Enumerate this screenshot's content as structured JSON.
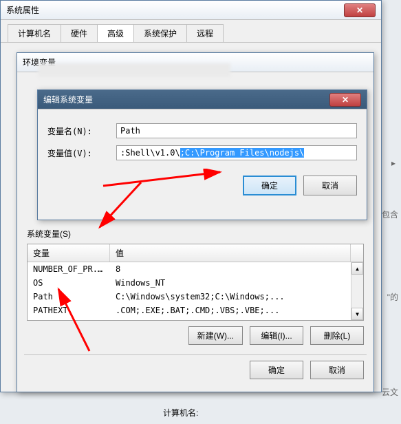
{
  "outer_bg": {
    "bottom_label": "计算机名:",
    "partial1": "\"的",
    "partial2": "包含",
    "partial3": "…",
    "partial4": "云文"
  },
  "sys_props": {
    "title": "系统属性",
    "tabs": [
      "计算机名",
      "硬件",
      "高级",
      "系统保护",
      "远程"
    ],
    "active_tab_index": 2
  },
  "env_vars": {
    "title": "环境变量",
    "sys_vars_label": "系统变量(S)",
    "table": {
      "headers": [
        "变量",
        "值"
      ],
      "rows": [
        {
          "name": "NUMBER_OF_PR...",
          "value": "8"
        },
        {
          "name": "OS",
          "value": "Windows_NT"
        },
        {
          "name": "Path",
          "value": "C:\\Windows\\system32;C:\\Windows;..."
        },
        {
          "name": "PATHEXT",
          "value": ".COM;.EXE;.BAT;.CMD;.VBS;.VBE;..."
        }
      ]
    },
    "buttons": {
      "new": "新建(W)...",
      "edit": "编辑(I)...",
      "delete": "删除(L)"
    },
    "ok": "确定",
    "cancel": "取消"
  },
  "edit_sys_var": {
    "title": "编辑系统变量",
    "name_label": "变量名(N):",
    "name_value": "Path",
    "value_label": "变量值(V):",
    "value_prefix": ":Shell\\v1.0\\",
    "value_selected": ";C:\\Program Files\\nodejs\\",
    "ok": "确定",
    "cancel": "取消"
  }
}
